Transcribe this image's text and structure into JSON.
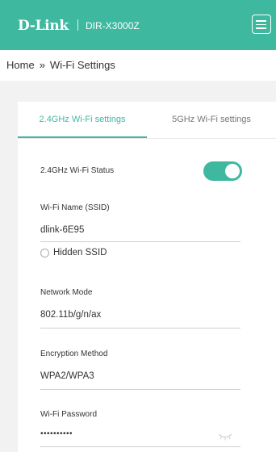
{
  "header": {
    "logo": "D-Link",
    "model": "DIR-X3000Z",
    "menu_icon": "hamburger-menu-icon",
    "background_color": "#3fb8a0"
  },
  "breadcrumb": {
    "home": "Home",
    "separator": "»",
    "current": "Wi-Fi Settings"
  },
  "tabs": [
    {
      "label": "2.4GHz Wi-Fi settings",
      "active": true
    },
    {
      "label": "5GHz Wi-Fi settings",
      "active": false
    }
  ],
  "form": {
    "status": {
      "label": "2.4GHz Wi-Fi Status",
      "enabled": true
    },
    "ssid": {
      "label": "Wi-Fi Name (SSID)",
      "value": "dlink-6E95"
    },
    "hidden_ssid": {
      "label": "Hidden SSID",
      "checked": false
    },
    "network_mode": {
      "label": "Network Mode",
      "value": "802.11b/g/n/ax"
    },
    "encryption": {
      "label": "Encryption Method",
      "value": "WPA2/WPA3"
    },
    "password": {
      "label": "Wi-Fi Password",
      "value": "••••••••••",
      "visibility_icon": "eye-closed-icon"
    }
  },
  "colors": {
    "accent": "#3fb8a0"
  }
}
